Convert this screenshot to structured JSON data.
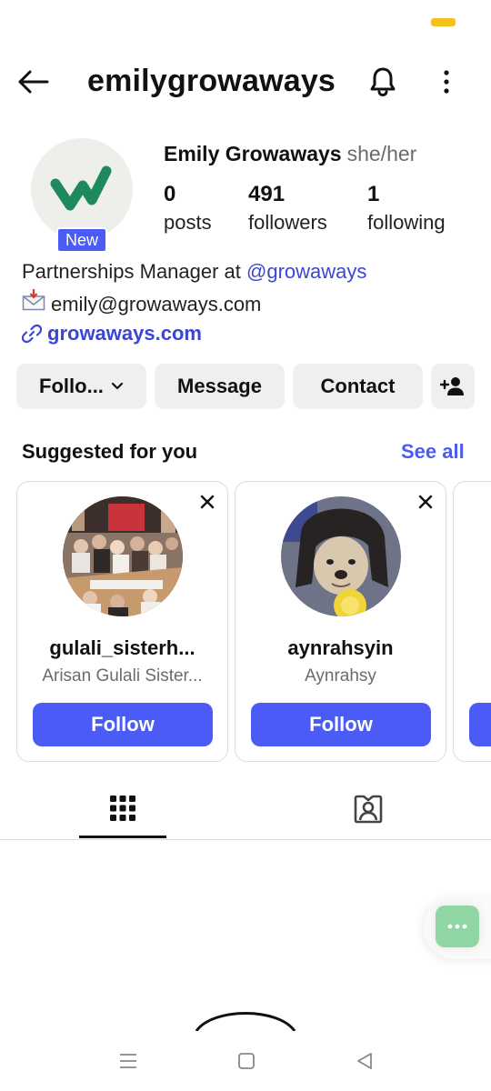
{
  "header": {
    "username": "emilygrowaways",
    "icons": {
      "back": "arrow-left-icon",
      "notifications": "bell-icon",
      "more": "more-vertical-icon"
    }
  },
  "profile": {
    "display_name": "Emily Growaways",
    "pronouns": "she/her",
    "new_badge": "New",
    "avatar_color": "#1e8a5c",
    "stats": {
      "posts": {
        "count": "0",
        "label": "posts"
      },
      "followers": {
        "count": "491",
        "label": "followers"
      },
      "following": {
        "count": "1",
        "label": "following"
      }
    },
    "bio": {
      "line1_prefix": "Partnerships Manager at ",
      "line1_mention": "@growaways",
      "line2_email": "emily@growaways.com",
      "link": "growaways.com"
    }
  },
  "actions": {
    "following_label": "Follo...",
    "message_label": "Message",
    "contact_label": "Contact"
  },
  "suggested": {
    "title": "Suggested for you",
    "see_all": "See all",
    "cards": [
      {
        "username": "gulali_sisterh...",
        "subtitle": "Arisan Gulali Sister...",
        "follow_label": "Follow"
      },
      {
        "username": "aynrahsyin",
        "subtitle": "Aynrahsy",
        "follow_label": "Follow"
      },
      {
        "username": "",
        "subtitle": "",
        "follow_label": ""
      }
    ]
  },
  "tabs": [
    {
      "icon": "grid-icon",
      "selected": true
    },
    {
      "icon": "tagged-person-icon",
      "selected": false
    }
  ],
  "colors": {
    "accent": "#4a5cf5",
    "link": "#3a46d6",
    "chat_bubble": "#8fd6a4"
  },
  "system_nav": {
    "icons": [
      "menu-icon",
      "home-square-icon",
      "back-triangle-icon"
    ]
  }
}
